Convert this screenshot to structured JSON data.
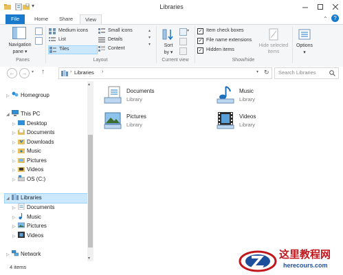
{
  "window": {
    "title": "Libraries"
  },
  "tabs": {
    "file": "File",
    "home": "Home",
    "share": "Share",
    "view": "View"
  },
  "ribbon": {
    "panes": {
      "nav_pane_line1": "Navigation",
      "nav_pane_line2": "pane",
      "label": "Panes"
    },
    "layout": {
      "label": "Layout",
      "items": [
        "Medium icons",
        "Small icons",
        "List",
        "Details",
        "Tiles",
        "Content"
      ],
      "selected": "Tiles"
    },
    "current_view": {
      "sort_line1": "Sort",
      "sort_line2": "by",
      "label": "Current view"
    },
    "show_hide": {
      "label": "Show/hide",
      "item_check_boxes": "Item check boxes",
      "file_name_extensions": "File name extensions",
      "hidden_items": "Hidden items",
      "hide_selected_line1": "Hide selected",
      "hide_selected_line2": "items"
    },
    "options": {
      "label": "Options"
    }
  },
  "address": {
    "crumb": "Libraries",
    "search_placeholder": "Search Libraries"
  },
  "nav_tree": {
    "homegroup": "Homegroup",
    "this_pc": "This PC",
    "pc_items": [
      "Desktop",
      "Documents",
      "Downloads",
      "Music",
      "Pictures",
      "Videos",
      "OS (C:)"
    ],
    "libraries": "Libraries",
    "lib_items": [
      "Documents",
      "Music",
      "Pictures",
      "Videos"
    ],
    "network": "Network"
  },
  "content": {
    "libraries": [
      {
        "name": "Documents",
        "sub": "Library"
      },
      {
        "name": "Music",
        "sub": "Library"
      },
      {
        "name": "Pictures",
        "sub": "Library"
      },
      {
        "name": "Videos",
        "sub": "Library"
      }
    ]
  },
  "status": {
    "count": "4 items"
  },
  "watermark": {
    "line1": "这里教程网",
    "line2": "herecours.com"
  },
  "colors": {
    "accent": "#1979ca",
    "selection": "#cce8ff",
    "watermark_red": "#c0171d",
    "watermark_blue": "#1d4f9c"
  }
}
